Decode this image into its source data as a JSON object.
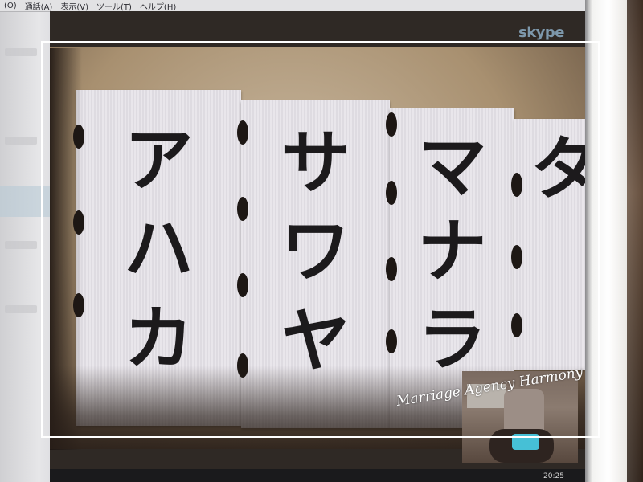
{
  "menubar": {
    "items": [
      "(O)",
      "通話(A)",
      "表示(V)",
      "ツール(T)",
      "ヘルプ(H)"
    ]
  },
  "video": {
    "brand_logo": "skype",
    "cards": [
      {
        "glyphs": [
          "ア",
          "ハ",
          "カ"
        ]
      },
      {
        "glyphs": [
          "サ",
          "ワ",
          "ヤ"
        ]
      },
      {
        "glyphs": [
          "マ",
          "ナ",
          "ラ"
        ]
      },
      {
        "glyphs": [
          "タ"
        ]
      }
    ]
  },
  "watermark": "Marriage Agency Harmony",
  "taskbar": {
    "clock": "20:25"
  },
  "colors": {
    "frame": "#ffffff",
    "card": "#e7e4ea",
    "glyph": "#1c1a1c",
    "background": "#2a2623"
  }
}
